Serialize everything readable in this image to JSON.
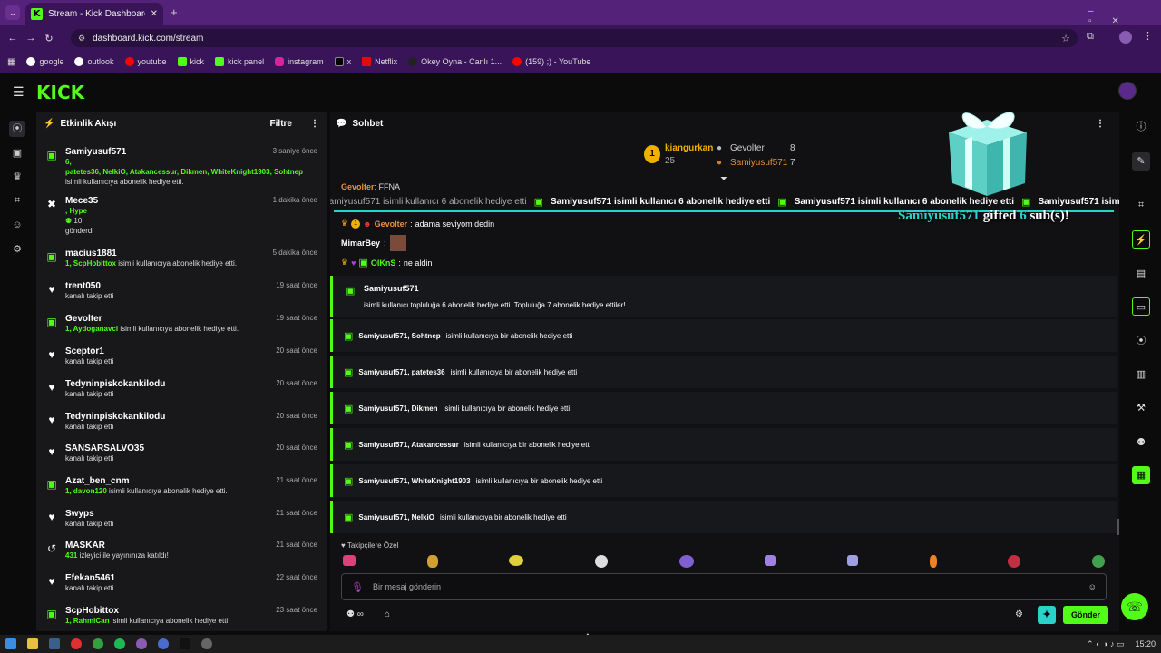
{
  "browser": {
    "tab_title": "Stream - Kick Dashboard",
    "url": "dashboard.kick.com/stream",
    "bookmarks": [
      "google",
      "outlook",
      "youtube",
      "kick",
      "kick panel",
      "instagram",
      "x",
      "Netflix",
      "Okey Oyna - Canlı 1...",
      "(159) ;) - YouTube"
    ]
  },
  "logo": "KICK",
  "activity": {
    "title": "Etkinlik Akışı",
    "filter": "Filtre",
    "items": [
      {
        "name": "Samiyusuf571",
        "time": "3 saniye önce",
        "l1": "6,",
        "l2": "patetes36, NelkiO, Atakancessur, Dikmen, WhiteKnight1903, Sohtnep",
        "l3": "isimli kullanıcıya abonelik hediye etti."
      },
      {
        "name": "Mece35",
        "time": "1 dakika önce",
        "l1": ", Hype",
        "l2": "10",
        "l3": "gönderdi"
      },
      {
        "name": "macius1881",
        "time": "5 dakika önce",
        "l1": "1, ScpHobittox",
        "l2": "isimli kullanıcıya abonelik hediye etti."
      },
      {
        "name": "trent050",
        "time": "19 saat önce",
        "l1": "kanalı takip etti"
      },
      {
        "name": "Gevolter",
        "time": "19 saat önce",
        "l1": "1, Aydoganavci",
        "l2": "isimli kullanıcıya abonelik hediye etti."
      },
      {
        "name": "Sceptor1",
        "time": "20 saat önce",
        "l1": "kanalı takip etti"
      },
      {
        "name": "Tedyninpiskokankilodu",
        "time": "20 saat önce",
        "l1": "kanalı takip etti"
      },
      {
        "name": "Tedyninpiskokankilodu",
        "time": "20 saat önce",
        "l1": "kanalı takip etti"
      },
      {
        "name": "SANSARSALVO35",
        "time": "20 saat önce",
        "l1": "kanalı takip etti"
      },
      {
        "name": "Azat_ben_cnm",
        "time": "21 saat önce",
        "l1": "1, davon120",
        "l2": "isimli kullanıcıya abonelik hediye etti."
      },
      {
        "name": "Swyps",
        "time": "21 saat önce",
        "l1": "kanalı takip etti"
      },
      {
        "name": "MASKAR",
        "time": "21 saat önce",
        "l1": "431",
        "l2": "izleyici ile yayınınıza katıldı!"
      },
      {
        "name": "Efekan5461",
        "time": "22 saat önce",
        "l1": "kanalı takip etti"
      },
      {
        "name": "ScpHobittox",
        "time": "23 saat önce",
        "l1": "1, RahmiCan",
        "l2": "isimli kullanıcıya abonelik hediye etti."
      }
    ]
  },
  "chat": {
    "title": "Sohbet",
    "leader": {
      "first": "kiangurkan",
      "first_count": "25",
      "second": "Gevolter",
      "second_count": "8",
      "third": "Samiyusuf571",
      "third_count": "7"
    },
    "ticker": "Samiyusuf571 isimli kullanıcı 6 abonelik hediye etti",
    "gifted_banner": {
      "name": "Samiyusuf571",
      "word": "gifted",
      "count": "6",
      "tail": "sub(s)!"
    },
    "messages": [
      {
        "user": "Gevolter",
        "text": "FFNA"
      },
      {
        "user": "Gevolter",
        "text": "adama seviyom dedin"
      },
      {
        "user": "MimarBey",
        "text": ""
      },
      {
        "user": "OlKnS",
        "text": "ne aldin"
      }
    ],
    "big_gift": {
      "name": "Samiyusuf571",
      "text": "isimli kullanıcı topluluğa 6 abonelik hediye etti. Topluluğa 7 abonelik hediye ettiler!"
    },
    "gifts": [
      {
        "users": "Samiyusuf571, Sohtnep",
        "text": "isimli kullanıcıya bir abonelik hediye etti"
      },
      {
        "users": "Samiyusuf571, patetes36",
        "text": "isimli kullanıcıya bir abonelik hediye etti"
      },
      {
        "users": "Samiyusuf571, Dikmen",
        "text": "isimli kullanıcıya bir abonelik hediye etti"
      },
      {
        "users": "Samiyusuf571, Atakancessur",
        "text": "isimli kullanıcıya bir abonelik hediye etti"
      },
      {
        "users": "Samiyusuf571, WhiteKnight1903",
        "text": "isimli kullanıcıya bir abonelik hediye etti"
      },
      {
        "users": "Samiyusuf571, NelkiO",
        "text": "isimli kullanıcıya bir abonelik hediye etti"
      }
    ],
    "emote_label": "Takipçilere Özel",
    "placeholder": "Bir mesaj gönderin",
    "send": "Gönder"
  },
  "taskbar": {
    "time": "15:20"
  },
  "colors": {
    "accent": "#53fc18",
    "chrome": "#3a1458",
    "panel": "#18181b"
  }
}
